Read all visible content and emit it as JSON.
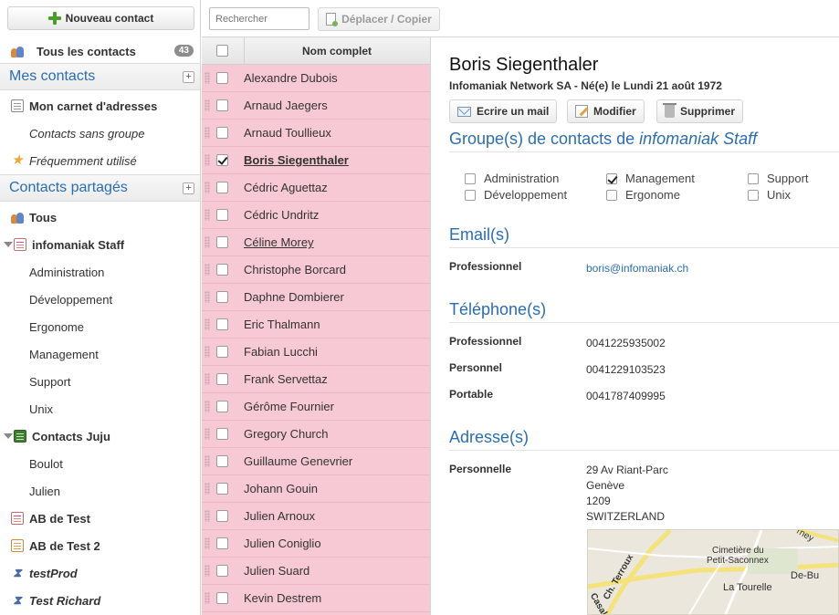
{
  "sidebar": {
    "new_contact_label": "Nouveau contact",
    "all_contacts": {
      "label": "Tous les contacts",
      "count": "43"
    },
    "my_contacts_title": "Mes contacts",
    "my_contacts_items": [
      "Mon carnet d'adresses",
      "Contacts sans groupe",
      "Fréquemment utilisé"
    ],
    "shared_title": "Contacts partagés",
    "shared_all": "Tous",
    "staff_book": "infomaniak Staff",
    "staff_groups": [
      "Administration",
      "Développement",
      "Ergonome",
      "Management",
      "Support",
      "Unix"
    ],
    "juju_book": "Contacts Juju",
    "juju_groups": [
      "Boulot",
      "Julien"
    ],
    "other_books": [
      "AB de Test",
      "AB de Test 2",
      "testProd",
      "Test Richard"
    ],
    "expand_symbol": "+"
  },
  "toolbar": {
    "search_placeholder": "Rechercher",
    "move_copy_label": "Déplacer / Copier"
  },
  "list": {
    "header": "Nom complet",
    "contacts": [
      "Alexandre Dubois",
      "Arnaud Jaegers",
      "Arnaud Toullieux",
      "Boris Siegenthaler",
      "Cédric Aguettaz",
      "Cédric Undritz",
      "Céline Morey",
      "Christophe Borcard",
      "Daphne Dombierer",
      "Eric Thalmann",
      "Fabian Lucchi",
      "Frank Servettaz",
      "Gérôme Fournier",
      "Gregory Church",
      "Guillaume Genevrier",
      "Johann Gouin",
      "Julien Arnoux",
      "Julien Coniglio",
      "Julien Suard",
      "Kevin Destrem"
    ]
  },
  "detail": {
    "name": "Boris Siegenthaler",
    "subtitle": "Infomaniak Network SA - Né(e) le Lundi 21 août 1972",
    "actions": {
      "email": "Ecrire un mail",
      "edit": "Modifier",
      "delete": "Supprimer"
    },
    "groups_title_prefix": "Groupe(s) de contacts de ",
    "groups_title_book": "infomaniak Staff",
    "groups": [
      {
        "label": "Administration",
        "checked": false
      },
      {
        "label": "Développement",
        "checked": false
      },
      {
        "label": "Management",
        "checked": true
      },
      {
        "label": "Ergonome",
        "checked": false
      },
      {
        "label": "Support",
        "checked": false
      },
      {
        "label": "Unix",
        "checked": false
      }
    ],
    "email_title": "Email(s)",
    "email": {
      "label": "Professionnel",
      "value": "boris@infomaniak.ch"
    },
    "phone_title": "Téléphone(s)",
    "phones": [
      {
        "label": "Professionnel",
        "value": "0041225935002"
      },
      {
        "label": "Personnel",
        "value": "0041229103523"
      },
      {
        "label": "Portable",
        "value": "0041787409995"
      }
    ],
    "address_title": "Adresse(s)",
    "address": {
      "label": "Personnelle",
      "lines": [
        "29 Av Riant-Parc",
        "Genève",
        "1209",
        "SWITZERLAND"
      ]
    },
    "map_labels": [
      "Cimetière du",
      "Petit-Saconnex",
      "La Tourelle",
      "De-Bu",
      "Ch. Terroux",
      "Casal",
      "rney"
    ]
  }
}
